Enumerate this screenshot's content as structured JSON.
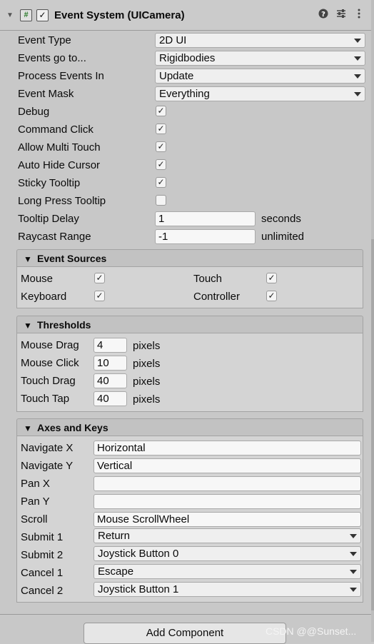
{
  "header": {
    "title": "Event System (UICamera)",
    "script_glyph": "#",
    "enabled_check": "✓"
  },
  "props": {
    "event_type": {
      "label": "Event Type",
      "value": "2D UI"
    },
    "events_go_to": {
      "label": "Events go to...",
      "value": "Rigidbodies"
    },
    "process_events_in": {
      "label": "Process Events In",
      "value": "Update"
    },
    "event_mask": {
      "label": "Event Mask",
      "value": "Everything"
    },
    "debug": {
      "label": "Debug",
      "checked": "✓"
    },
    "command_click": {
      "label": "Command Click",
      "checked": "✓"
    },
    "allow_multi_touch": {
      "label": "Allow Multi Touch",
      "checked": "✓"
    },
    "auto_hide_cursor": {
      "label": "Auto Hide Cursor",
      "checked": "✓"
    },
    "sticky_tooltip": {
      "label": "Sticky Tooltip",
      "checked": "✓"
    },
    "long_press_tooltip": {
      "label": "Long Press Tooltip",
      "checked": ""
    },
    "tooltip_delay": {
      "label": "Tooltip Delay",
      "value": "1",
      "unit": "seconds"
    },
    "raycast_range": {
      "label": "Raycast Range",
      "value": "-1",
      "unit": "unlimited"
    }
  },
  "event_sources": {
    "title": "Event Sources",
    "mouse": {
      "label": "Mouse",
      "checked": "✓"
    },
    "touch": {
      "label": "Touch",
      "checked": "✓"
    },
    "keyboard": {
      "label": "Keyboard",
      "checked": "✓"
    },
    "controller": {
      "label": "Controller",
      "checked": "✓"
    }
  },
  "thresholds": {
    "title": "Thresholds",
    "unit": "pixels",
    "mouse_drag": {
      "label": "Mouse Drag",
      "value": "4"
    },
    "mouse_click": {
      "label": "Mouse Click",
      "value": "10"
    },
    "touch_drag": {
      "label": "Touch Drag",
      "value": "40"
    },
    "touch_tap": {
      "label": "Touch Tap",
      "value": "40"
    }
  },
  "axes": {
    "title": "Axes and Keys",
    "navigate_x": {
      "label": "Navigate X",
      "value": "Horizontal"
    },
    "navigate_y": {
      "label": "Navigate Y",
      "value": "Vertical"
    },
    "pan_x": {
      "label": "Pan X",
      "value": ""
    },
    "pan_y": {
      "label": "Pan Y",
      "value": ""
    },
    "scroll": {
      "label": "Scroll",
      "value": "Mouse ScrollWheel"
    },
    "submit_1": {
      "label": "Submit 1",
      "value": "Return"
    },
    "submit_2": {
      "label": "Submit 2",
      "value": "Joystick Button 0"
    },
    "cancel_1": {
      "label": "Cancel 1",
      "value": "Escape"
    },
    "cancel_2": {
      "label": "Cancel 2",
      "value": "Joystick Button 1"
    }
  },
  "add_component": "Add Component",
  "watermark": "CSDN @@Sunset..."
}
